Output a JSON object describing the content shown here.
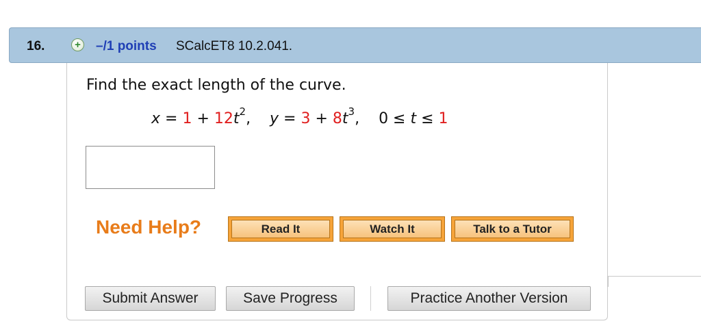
{
  "question": {
    "number": "16.",
    "points": "–/1 points",
    "source": "SCalcET8 10.2.041."
  },
  "problem": {
    "prompt": "Find the exact length of the curve.",
    "equation": {
      "x_var": "x",
      "x_eq": " = ",
      "x_a": "1",
      "x_plus": " + ",
      "x_b": "12",
      "x_t": "t",
      "x_exp": "2",
      "x_sep": ",    ",
      "y_var": "y",
      "y_eq": " = ",
      "y_a": "3",
      "y_plus": " + ",
      "y_b": "8",
      "y_t": "t",
      "y_exp": "3",
      "y_sep": ",    ",
      "range_low": "0",
      "range_le1": " ≤ ",
      "range_t": "t",
      "range_le2": " ≤ ",
      "range_high": "1"
    }
  },
  "answer": {
    "value": ""
  },
  "help": {
    "label": "Need Help?",
    "read_it": "Read It",
    "watch_it": "Watch It",
    "talk_tutor": "Talk to a Tutor"
  },
  "actions": {
    "submit": "Submit Answer",
    "save": "Save Progress",
    "practice": "Practice Another Version"
  },
  "colors": {
    "header_bg": "#a9c6de",
    "points_text": "#1f3fb5",
    "highlight_red": "#e01e1e",
    "need_help": "#e87c1a",
    "help_button": "#f6a43a"
  }
}
